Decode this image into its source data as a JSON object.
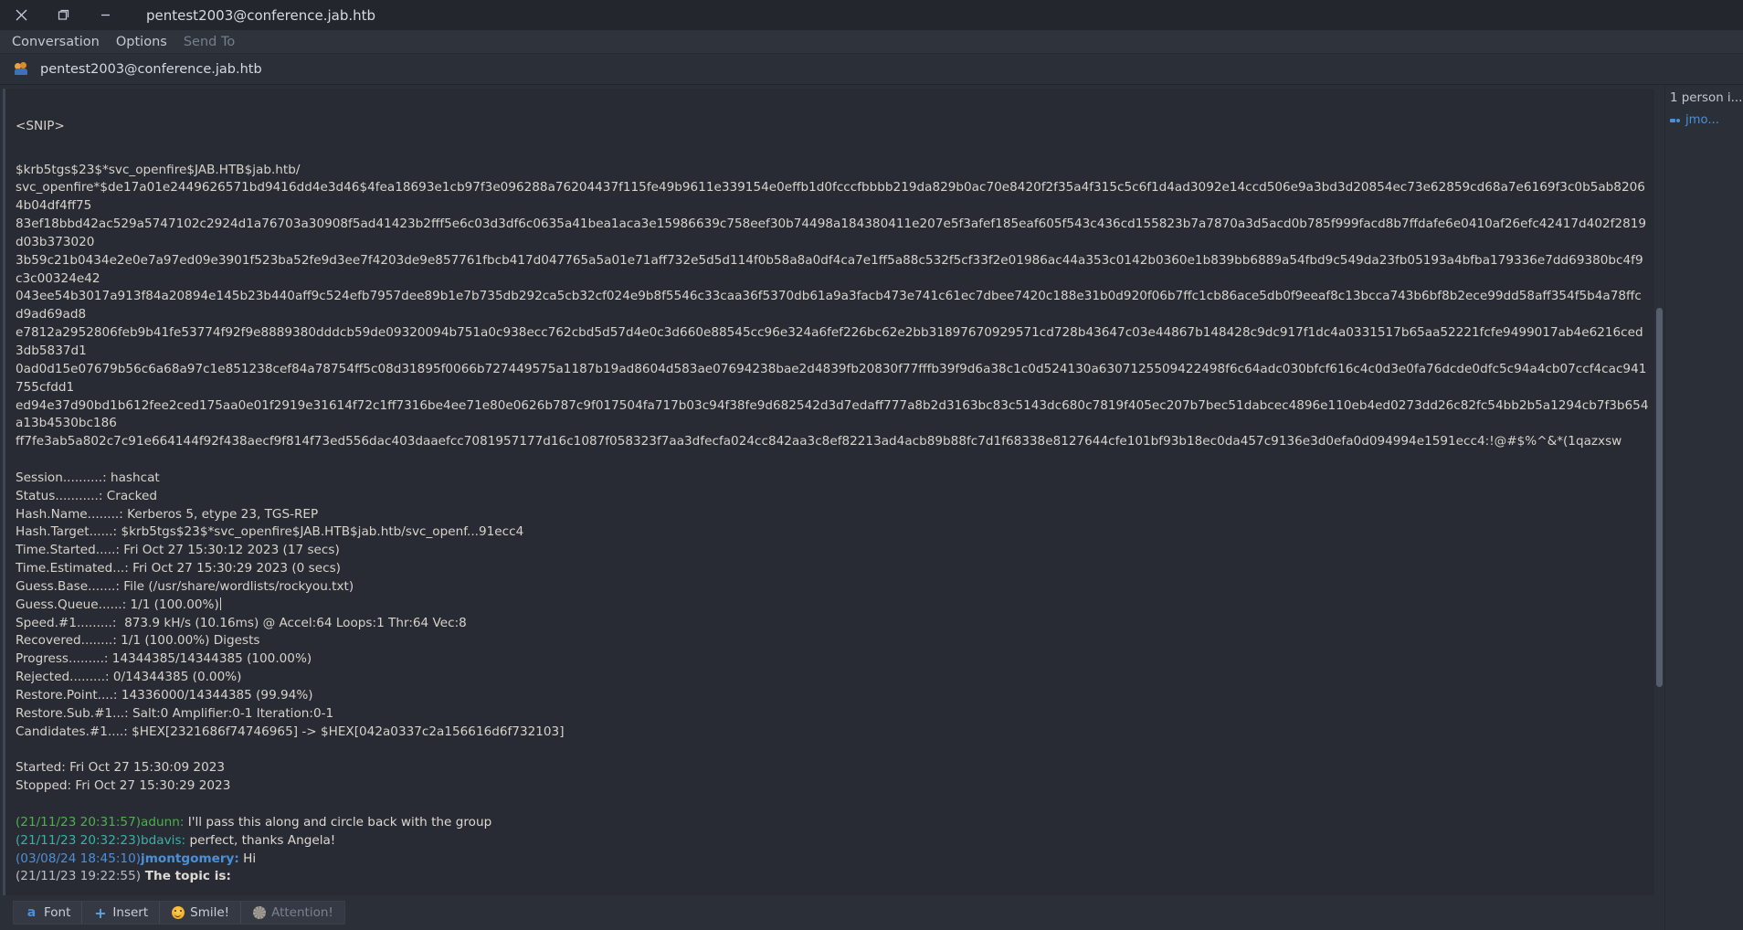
{
  "window": {
    "title": "pentest2003@conference.jab.htb",
    "controls": {
      "close": "close-icon",
      "restore": "restore-icon",
      "minimize": "minimize-icon"
    }
  },
  "menubar": {
    "items": [
      {
        "label": "Conversation",
        "disabled": false
      },
      {
        "label": "Options",
        "disabled": false
      },
      {
        "label": "Send To",
        "disabled": true
      }
    ]
  },
  "tab": {
    "label": "pentest2003@conference.jab.htb",
    "icon": "group-chat-icon"
  },
  "log": {
    "snip": "<SNIP>",
    "hash_lines": [
      "$krb5tgs$23$*svc_openfire$JAB.HTB$jab.htb/",
      "svc_openfire*$de17a01e2449626571bd9416dd4e3d46$4fea18693e1cb97f3e096288a76204437f115fe49b9611e339154e0effb1d0fcccfbbbb219da829b0ac70e8420f2f35a4f315c5c6f1d4ad3092e14ccd506e9a3bd3d20854ec73e62859cd68a7e6169f3c0b5ab82064b04df4ff75",
      "83ef18bbd42ac529a5747102c2924d1a76703a30908f5ad41423b2fff5e6c03d3df6c0635a41bea1aca3e15986639c758eef30b74498a184380411e207e5f3afef185eaf605f543c436cd155823b7a7870a3d5acd0b785f999facd8b7ffdafe6e0410af26efc42417d402f2819d03b373020",
      "3b59c21b0434e2e0e7a97ed09e3901f523ba52fe9d3ee7f4203de9e857761fbcb417d047765a5a01e71aff732e5d5d114f0b58a8a0df4ca7e1ff5a88c532f5cf33f2e01986ac44a353c0142b0360e1b839bb6889a54fbd9c549da23fb05193a4bfba179336e7dd69380bc4f9c3c00324e42",
      "043ee54b3017a913f84a20894e145b23b440aff9c524efb7957dee89b1e7b735db292ca5cb32cf024e9b8f5546c33caa36f5370db61a9a3facb473e741c61ec7dbee7420c188e31b0d920f06b7ffc1cb86ace5db0f9eeaf8c13bcca743b6bf8b2ece99dd58aff354f5b4a78ffcd9ad69ad8",
      "e7812a2952806feb9b41fe53774f92f9e8889380dddcb59de09320094b751a0c938ecc762cbd5d57d4e0c3d660e88545cc96e324a6fef226bc62e2bb31897670929571cd728b43647c03e44867b148428c9dc917f1dc4a0331517b65aa52221fcfe9499017ab4e6216ced3db5837d1",
      "0ad0d15e07679b56c6a68a97c1e851238cef84a78754ff5c08d31895f0066b727449575a1187b19ad8604d583ae07694238bae2d4839fb20830f77fffb39f9d6a38c1c0d524130a6307125509422498f6c64adc030bfcf616c4c0d3e0fa76dcde0dfc5c94a4cb07ccf4cac941755cfdd1",
      "ed94e37d90bd1b612fee2ced175aa0e01f2919e31614f72c1ff7316be4ee71e80e0626b787c9f017504fa717b03c94f38fe9d682542d3d7edaff777a8b2d3163bc83c5143dc680c7819f405ec207b7bec51dabcec4896e110eb4ed0273dd26c82fc54bb2b5a1294cb7f3b654a13b4530bc186",
      "ff7fe3ab5a802c7c91e664144f92f438aecf9f814f73ed556dac403daaefcc7081957177d16c1087f058323f7aa3dfecfa024cc842aa3c8ef82213ad4acb89b88fc7d1f68338e8127644cfe101bf93b18ec0da457c9136e3d0efa0d094994e1591ecc4:!@#$%^&*(1qazxsw"
    ],
    "stats": [
      "Session..........: hashcat",
      "Status...........: Cracked",
      "Hash.Name........: Kerberos 5, etype 23, TGS-REP",
      "Hash.Target......: $krb5tgs$23$*svc_openfire$JAB.HTB$jab.htb/svc_openf...91ecc4",
      "Time.Started.....: Fri Oct 27 15:30:12 2023 (17 secs)",
      "Time.Estimated...: Fri Oct 27 15:30:29 2023 (0 secs)",
      "Guess.Base.......: File (/usr/share/wordlists/rockyou.txt)"
    ],
    "stats_cursor_line": "Guess.Queue......: 1/1 (100.00%)",
    "stats_after": [
      "Speed.#1.........:  873.9 kH/s (10.16ms) @ Accel:64 Loops:1 Thr:64 Vec:8",
      "Recovered........: 1/1 (100.00%) Digests",
      "Progress.........: 14344385/14344385 (100.00%)",
      "Rejected.........: 0/14344385 (0.00%)",
      "Restore.Point....: 14336000/14344385 (99.94%)",
      "Restore.Sub.#1...: Salt:0 Amplifier:0-1 Iteration:0-1",
      "Candidates.#1....: $HEX[2321686f74746965] -> $HEX[042a0337c2a156616d6f732103]"
    ],
    "started": "Started: Fri Oct 27 15:30:09 2023",
    "stopped": "Stopped: Fri Oct 27 15:30:29 2023"
  },
  "messages": [
    {
      "time": "(21/11/23 20:31:57)",
      "nick": "adunn:",
      "text": " I'll pass this along and circle back with the group",
      "time_color": "ts-green",
      "nick_color": "nick-green"
    },
    {
      "time": "(21/11/23 20:32:23)",
      "nick": "bdavis:",
      "text": " perfect, thanks Angela!",
      "time_color": "ts-teal",
      "nick_color": "nick-teal"
    },
    {
      "time": "(03/08/24 18:45:10)",
      "nick": "jmontgomery:",
      "text": " Hi",
      "time_color": "ts-blue",
      "nick_color": "nick-blue"
    }
  ],
  "topic": {
    "time": "(21/11/23 19:22:55)",
    "text": " The topic is:"
  },
  "toolbar": {
    "font": "Font",
    "insert": "Insert",
    "smile": "Smile!",
    "attention": "Attention!"
  },
  "sidebar": {
    "header": "1 person i...",
    "people": [
      {
        "name": "jmo..."
      }
    ]
  },
  "colors": {
    "window_bg": "#2b2f38",
    "titlebar_bg": "#23262d",
    "chat_bg": "#282b33",
    "accent_blue": "#4a90d9",
    "text": "#d7d3cb"
  }
}
